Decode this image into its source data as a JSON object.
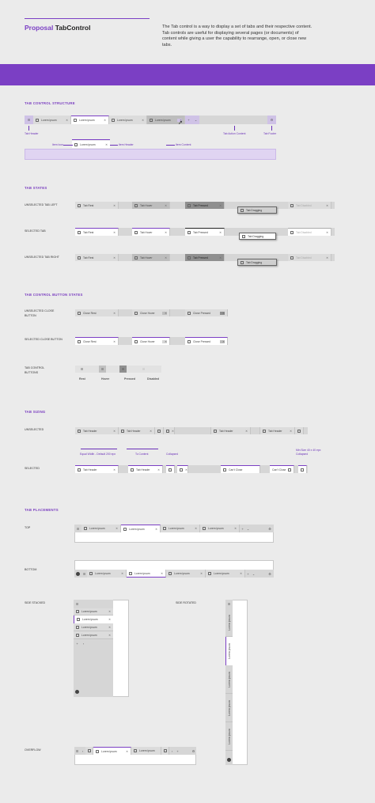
{
  "header": {
    "title_prefix": "Proposal",
    "title_main": "TabControl",
    "description": "The Tab control is a way to display a set of tabs and their respective content. Tab controls are useful for displaying several pages (or documents) of content while giving a user the capability to rearrange, open, or close new tabs."
  },
  "colors": {
    "accent": "#7b3fc4",
    "banner": "#7b3fc4",
    "background": "#ebebeb"
  },
  "icons": {
    "doc": "document-icon",
    "close": "close-icon",
    "add": "plus-icon",
    "menu": "menu-icon",
    "settings": "gear-icon",
    "cursor": "cursor-icon"
  },
  "structure": {
    "section": "TAB CONTROL STRUCTURE",
    "tab_label": "Lorem ipsum",
    "annotations": {
      "header": "Tab Header",
      "action": "Tab Action Content",
      "footer": "Tab Footer",
      "item_icon": "Item Icon",
      "item_header": "Item Header",
      "item_content": "Item Content"
    }
  },
  "states": {
    "section": "TAB STATES",
    "row_unselected_left": "UNSELECTED TAB LEFT",
    "row_selected": "SELECTED TAB",
    "row_unselected_right": "UNSELECTED TAB RIGHT",
    "rest": "Tab Rest",
    "hover": "Tab Hover",
    "pressed": "Tab Pressed",
    "dragging": "Tab Dragging",
    "disabled": "Tab Disabled"
  },
  "buttons": {
    "section": "TAB CONTROL BUTTON STATES",
    "row_unselected": "UNSELECTED CLOSE BUTTON",
    "row_selected": "SELECTED CLOSE BUTTON",
    "row_tabcontrol": "TAB CONTROL BUTTONS",
    "close_rest": "Close Rest",
    "close_hover": "Close Hover",
    "close_pressed": "Close Pressed",
    "rest": "Rest",
    "hover": "Hover",
    "pressed": "Pressed",
    "disabled": "Disabled"
  },
  "sizing": {
    "section": "TAB SIZING",
    "row_unselected": "UNSELECTED",
    "row_selected": "SELECTED",
    "tab_header": "Tab Header",
    "cant_close": "Can't Close",
    "equal_width": "Equal Width - Default 200 epx",
    "to_content": "To Content",
    "collapsed": "Collapsed",
    "min_size": "Min Size 40 x 40 epx",
    "collapsed2": "Collapsed"
  },
  "placements": {
    "section": "TAB PLACEMENTS",
    "top": "TOP",
    "bottom": "BOTTOM",
    "side_stacked": "SIDE STACKED",
    "side_rotated": "SIDE ROTATED",
    "overflow": "OVERFLOW",
    "tab_label": "Lorem ipsum"
  }
}
